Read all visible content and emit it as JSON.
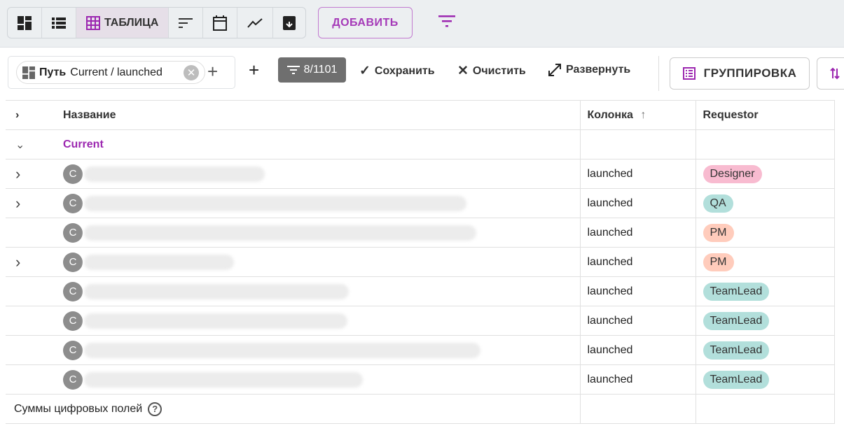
{
  "toolbar": {
    "views": [
      {
        "icon": "dashboard-icon"
      },
      {
        "icon": "list-icon"
      },
      {
        "icon": "table-icon",
        "label": "ТАБЛИЦА",
        "active": true
      },
      {
        "icon": "sort-lines-icon"
      },
      {
        "icon": "calendar-icon"
      },
      {
        "icon": "chart-line-icon"
      },
      {
        "icon": "archive-icon"
      }
    ],
    "add_label": "ДОБАВИТЬ",
    "accent": "#9c27b0"
  },
  "filters": {
    "chip_label": "Путь",
    "chip_value": "Current / launched",
    "count": "8/1101",
    "save": "Сохранить",
    "clear": "Очистить",
    "expand": "Развернуть",
    "grouping": "ГРУППИРОВКА"
  },
  "table": {
    "headers": {
      "name": "Название",
      "column": "Колонка",
      "requestor": "Requestor"
    },
    "group": "Current",
    "rows": [
      {
        "avatar": "C",
        "column": "launched",
        "requestor": "Designer",
        "color": "#f8bbd0",
        "expandable": true
      },
      {
        "avatar": "C",
        "column": "launched",
        "requestor": "QA",
        "color": "#b2dfdb",
        "expandable": true
      },
      {
        "avatar": "C",
        "column": "launched",
        "requestor": "PM",
        "color": "#ffccbc",
        "expandable": false
      },
      {
        "avatar": "C",
        "column": "launched",
        "requestor": "PM",
        "color": "#ffccbc",
        "expandable": true
      },
      {
        "avatar": "C",
        "column": "launched",
        "requestor": "TeamLead",
        "color": "#b2dfdb",
        "expandable": false
      },
      {
        "avatar": "C",
        "column": "launched",
        "requestor": "TeamLead",
        "color": "#b2dfdb",
        "expandable": false
      },
      {
        "avatar": "C",
        "column": "launched",
        "requestor": "TeamLead",
        "color": "#b2dfdb",
        "expandable": false
      },
      {
        "avatar": "C",
        "column": "launched",
        "requestor": "TeamLead",
        "color": "#b2dfdb",
        "expandable": false
      }
    ],
    "footer": "Суммы цифровых полей",
    "help": "?"
  }
}
